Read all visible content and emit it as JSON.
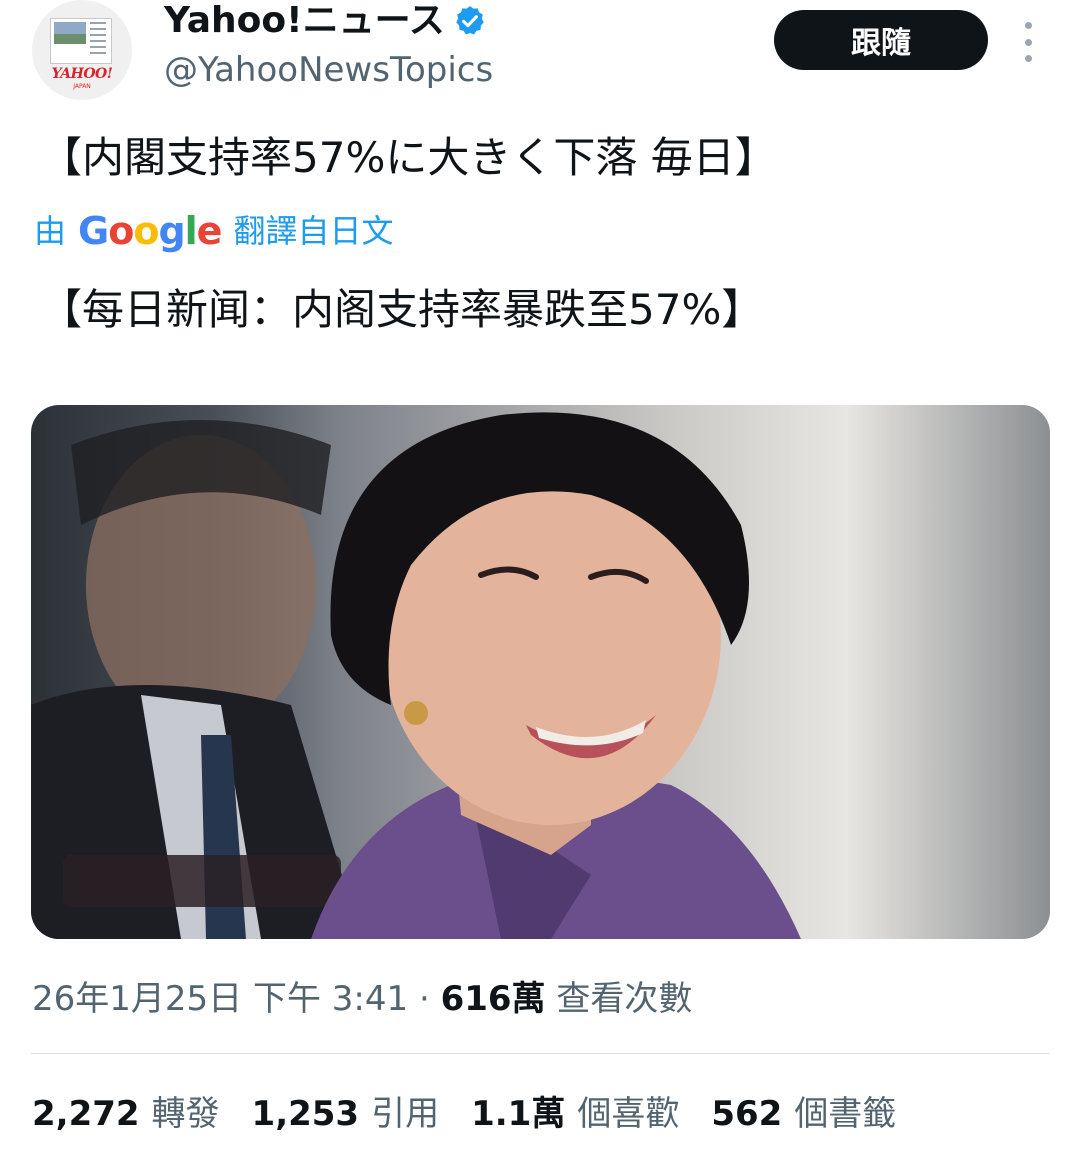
{
  "account": {
    "display_name": "Yahoo!ニュース",
    "handle": "@YahooNewsTopics",
    "avatar_brand": "YAHOO!",
    "avatar_brand_sub": "JAPAN",
    "verified_color": "#1d9bf0"
  },
  "follow_button_label": "跟隨",
  "more_icon": "more-vertical-icon",
  "tweet": {
    "text": "【内閣支持率57%に大きく下落 毎日】",
    "translate_prefix": "由",
    "translate_provider": "Google",
    "translate_suffix": "翻譯自日文",
    "translated_text": "【每日新闻：内阁支持率暴跌至57%】"
  },
  "meta": {
    "timestamp": "26年1月25日 下午 3:41",
    "separator": "·",
    "views_count": "616萬",
    "views_label": "查看次數"
  },
  "stats": [
    {
      "value": "2,272",
      "label": "轉發"
    },
    {
      "value": "1,253",
      "label": "引用"
    },
    {
      "value": "1.1萬",
      "label": "個喜歡"
    },
    {
      "value": "562",
      "label": "個書籤"
    }
  ],
  "colors": {
    "accent": "#1d9bf0",
    "text_primary": "#0f1419",
    "text_secondary": "#536471"
  }
}
